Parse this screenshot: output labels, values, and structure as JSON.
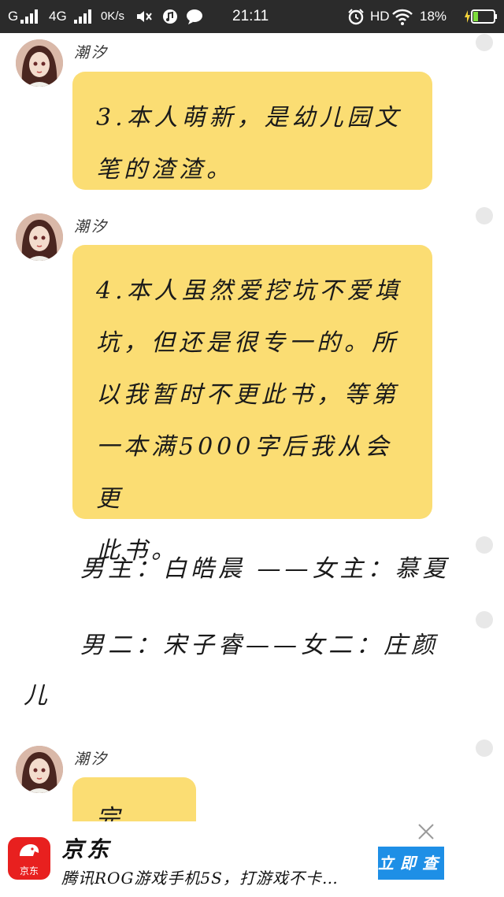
{
  "status_bar": {
    "carrier1": "G",
    "carrier2": "4G",
    "speed": "0K/s",
    "time": "21:11",
    "hd": "HD",
    "battery": "18%"
  },
  "messages": [
    {
      "sender": "潮汐",
      "lines": [
        "3.本人萌新，是幼儿园文",
        "笔的渣渣。"
      ]
    },
    {
      "sender": "潮汐",
      "lines": [
        "4.本人虽然爱挖坑不爱填",
        "坑，但还是很专一的。所",
        "以我暂时不更此书，等第",
        "一本满5000字后我从会更",
        "此书。"
      ]
    },
    {
      "sender": "潮汐",
      "lines": [
        "完毕。"
      ]
    }
  ],
  "narration": {
    "line1": "男主：白皓晨 ——女主：慕夏",
    "line2a": "男二：宋子睿——女二：庄颜",
    "line2b": "儿"
  },
  "ad": {
    "logo_text": "京东",
    "title": "京东",
    "description": "腾讯ROG游戏手机5S，打游戏不卡…",
    "button": "立即查"
  },
  "colors": {
    "bubble": "#fbdd73",
    "status_bar": "#2b2b2b",
    "ad_button": "#1e8fe6",
    "jd_red": "#e8201f"
  }
}
